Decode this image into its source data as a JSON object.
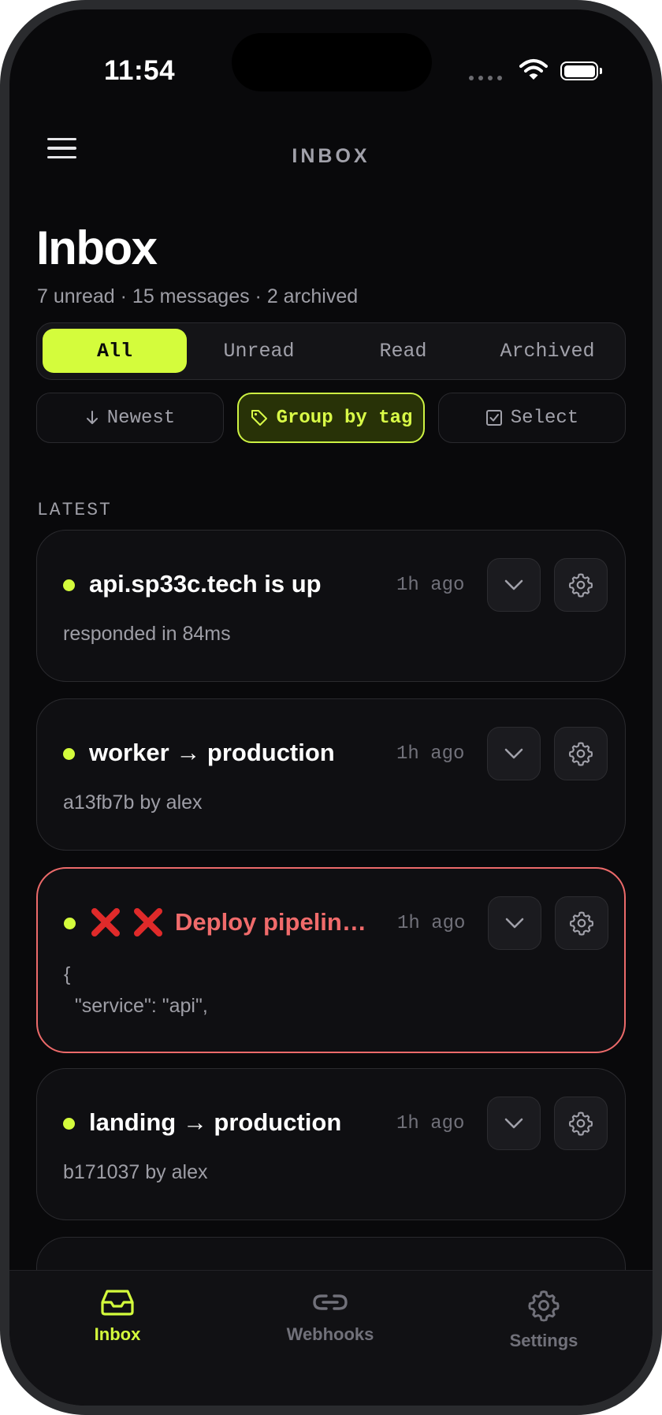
{
  "status_bar": {
    "time": "11:54"
  },
  "header": {
    "title": "INBOX"
  },
  "page": {
    "title": "Inbox",
    "subtitle": "7 unread · 15 messages · 2 archived"
  },
  "filters": {
    "tabs": [
      {
        "label": "All",
        "active": true
      },
      {
        "label": "Unread",
        "active": false
      },
      {
        "label": "Read",
        "active": false
      },
      {
        "label": "Archived",
        "active": false
      }
    ]
  },
  "actions": {
    "sort_label": "Newest",
    "group_label": "Group by tag",
    "select_label": "Select"
  },
  "section_label": "LATEST",
  "messages": [
    {
      "title": "api.sp33c.tech is up",
      "time": "1h ago",
      "body": "responded in 84ms",
      "status": "normal"
    },
    {
      "title": "worker → production",
      "time": "1h ago",
      "body": "a13fb7b by alex",
      "status": "normal"
    },
    {
      "title": "Deploy pipeline failed",
      "time": "1h ago",
      "body": "{\n  \"service\": \"api\",",
      "status": "error",
      "icons": [
        "x-icon",
        "x-icon"
      ]
    },
    {
      "title": "landing → production",
      "time": "1h ago",
      "body": "b171037 by alex",
      "status": "normal"
    }
  ],
  "tabbar": {
    "items": [
      {
        "label": "Inbox",
        "icon": "inbox-icon",
        "active": true
      },
      {
        "label": "Webhooks",
        "icon": "link-icon",
        "active": false
      },
      {
        "label": "Settings",
        "icon": "gear-icon",
        "active": false
      }
    ]
  },
  "colors": {
    "accent": "#d4fc3c",
    "error": "#f06b6b",
    "background": "#09090b"
  }
}
